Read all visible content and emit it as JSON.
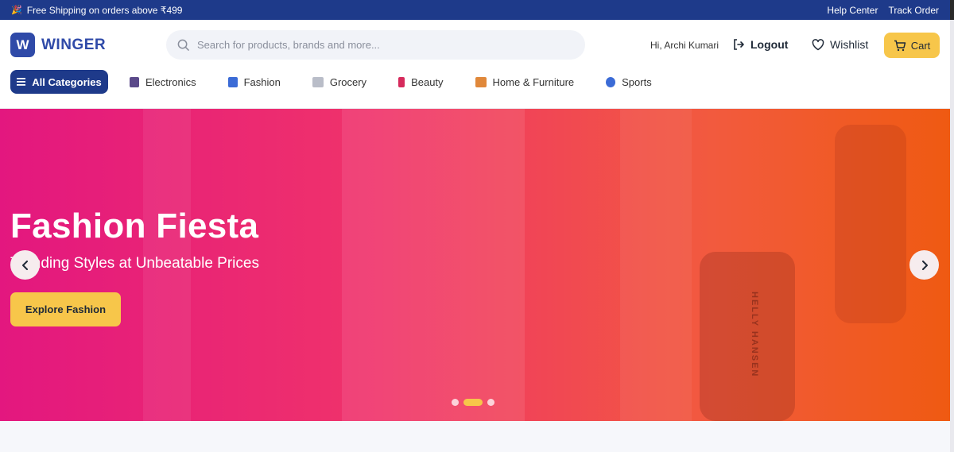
{
  "topbar": {
    "promo": "Free Shipping on orders above ₹499",
    "help": "Help Center",
    "track": "Track Order"
  },
  "brand": {
    "mark": "W",
    "name": "WINGER"
  },
  "search": {
    "placeholder": "Search for products, brands and more..."
  },
  "user": {
    "greeting": "Hi, Archi Kumari"
  },
  "header_actions": {
    "logout": "Logout",
    "wishlist": "Wishlist",
    "cart": "Cart"
  },
  "nav": {
    "all": "All Categories",
    "items": [
      {
        "label": "Electronics",
        "icon": "phone-icon",
        "color": "#5b4a8a"
      },
      {
        "label": "Fashion",
        "icon": "shirt-icon",
        "color": "#3b6bd6"
      },
      {
        "label": "Grocery",
        "icon": "cart-icon",
        "color": "#8a8f9c"
      },
      {
        "label": "Beauty",
        "icon": "lipstick-icon",
        "color": "#d62a5c"
      },
      {
        "label": "Home & Furniture",
        "icon": "house-icon",
        "color": "#e0883a"
      },
      {
        "label": "Sports",
        "icon": "globe-icon",
        "color": "#3b6bd6"
      }
    ]
  },
  "hero": {
    "title": "Fashion Fiesta",
    "subtitle": "Trending Styles at Unbeatable Prices",
    "cta": "Explore Fashion",
    "slide_count": 3,
    "active_slide": 2,
    "image_text": "HELLY HANSEN"
  },
  "colors": {
    "primary": "#1e3a8a",
    "accent": "#f7c64a",
    "hero_start": "#e3177f",
    "hero_end": "#ef5a12"
  }
}
